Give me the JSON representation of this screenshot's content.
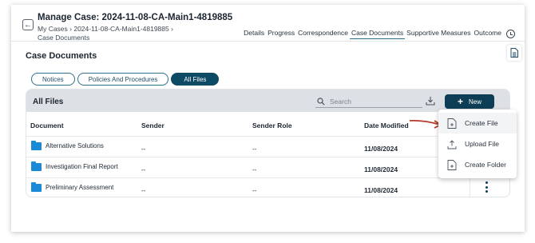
{
  "header": {
    "case_title": "Manage Case: 2024-11-08-CA-Main1-4819885",
    "breadcrumb_line1": "My Cases › 2024-11-08-CA-Main1-4819885 ›",
    "breadcrumb_line2": "Case Documents",
    "back_icon": "arrow-left-icon",
    "tabs": [
      {
        "label": "Details"
      },
      {
        "label": "Progress"
      },
      {
        "label": "Correspondence"
      },
      {
        "label": "Case Documents",
        "active": true
      },
      {
        "label": "Supportive Measures"
      },
      {
        "label": "Outcome"
      }
    ],
    "history_icon": "clock-history-icon"
  },
  "page": {
    "heading": "Case Documents",
    "side_icon": "document-icon"
  },
  "filters": [
    {
      "label": "Notices"
    },
    {
      "label": "Policies And Procedures"
    },
    {
      "label": "All Files",
      "active": true
    }
  ],
  "card": {
    "title": "All Files",
    "search_placeholder": "Search",
    "new_label": "New",
    "columns": [
      "Document",
      "Sender",
      "Sender Role",
      "Date Modified"
    ],
    "rows": [
      {
        "document": "Alternative Solutions",
        "sender": "--",
        "sender_role": "--",
        "date_modified": "11/08/2024"
      },
      {
        "document": "Investigation Final Report",
        "sender": "--",
        "sender_role": "--",
        "date_modified": "11/08/2024"
      },
      {
        "document": "Preliminary Assessment",
        "sender": "--",
        "sender_role": "--",
        "date_modified": "11/08/2024"
      }
    ]
  },
  "new_menu": {
    "items": [
      {
        "label": "Create File",
        "icon": "file-plus-icon",
        "highlighted": true
      },
      {
        "label": "Upload File",
        "icon": "upload-icon"
      },
      {
        "label": "Create Folder",
        "icon": "folder-plus-icon"
      }
    ]
  },
  "colors": {
    "primary": "#0d3e55",
    "pill_active": "#0d4a64",
    "folder": "#1b8ad6",
    "annotation_arrow": "#b33a2a"
  }
}
